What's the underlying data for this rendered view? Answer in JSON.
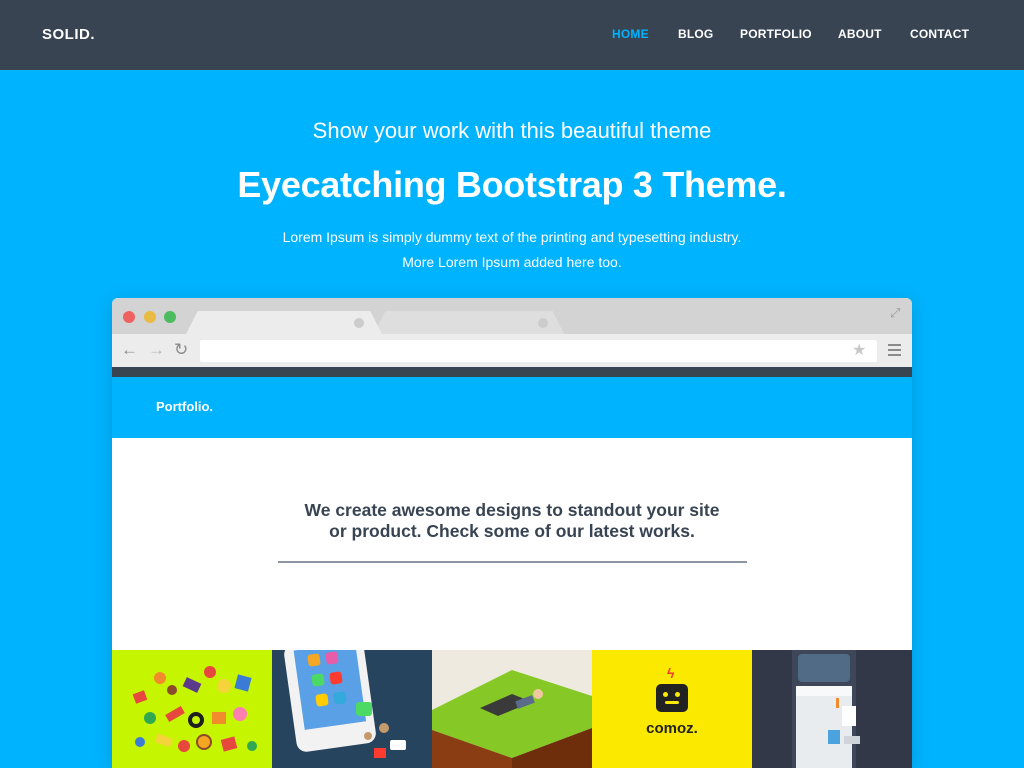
{
  "navbar": {
    "brand": "SOLID.",
    "links": [
      {
        "label": "HOME",
        "active": true
      },
      {
        "label": "BLOG",
        "active": false
      },
      {
        "label": "PORTFOLIO",
        "active": false
      },
      {
        "label": "ABOUT",
        "active": false
      },
      {
        "label": "CONTACT",
        "active": false
      }
    ]
  },
  "hero": {
    "subtitle": "Show your work with this beautiful theme",
    "title": "Eyecatching Bootstrap 3 Theme.",
    "text_line1": "Lorem Ipsum is simply dummy text of the printing and typesetting industry.",
    "text_line2": "More Lorem Ipsum added here too."
  },
  "browser": {
    "url_value": "",
    "icons": [
      "back-arrow-icon",
      "forward-arrow-icon",
      "reload-icon",
      "star-icon",
      "menu-icon",
      "expand-icon"
    ],
    "inner_site": {
      "brand": "Portfolio.",
      "tagline_line1": "We create awesome designs to standout your site",
      "tagline_line2": "or product. Check some of our latest works."
    },
    "thumbnails": [
      {
        "name": "thumb-candies"
      },
      {
        "name": "thumb-phone"
      },
      {
        "name": "thumb-landscape"
      },
      {
        "name": "thumb-comoz",
        "label": "comoz."
      },
      {
        "name": "thumb-water-cooler"
      }
    ]
  },
  "colors": {
    "accent": "#00b3fe",
    "navbar_bg": "#384452",
    "text_dark": "#384452"
  }
}
